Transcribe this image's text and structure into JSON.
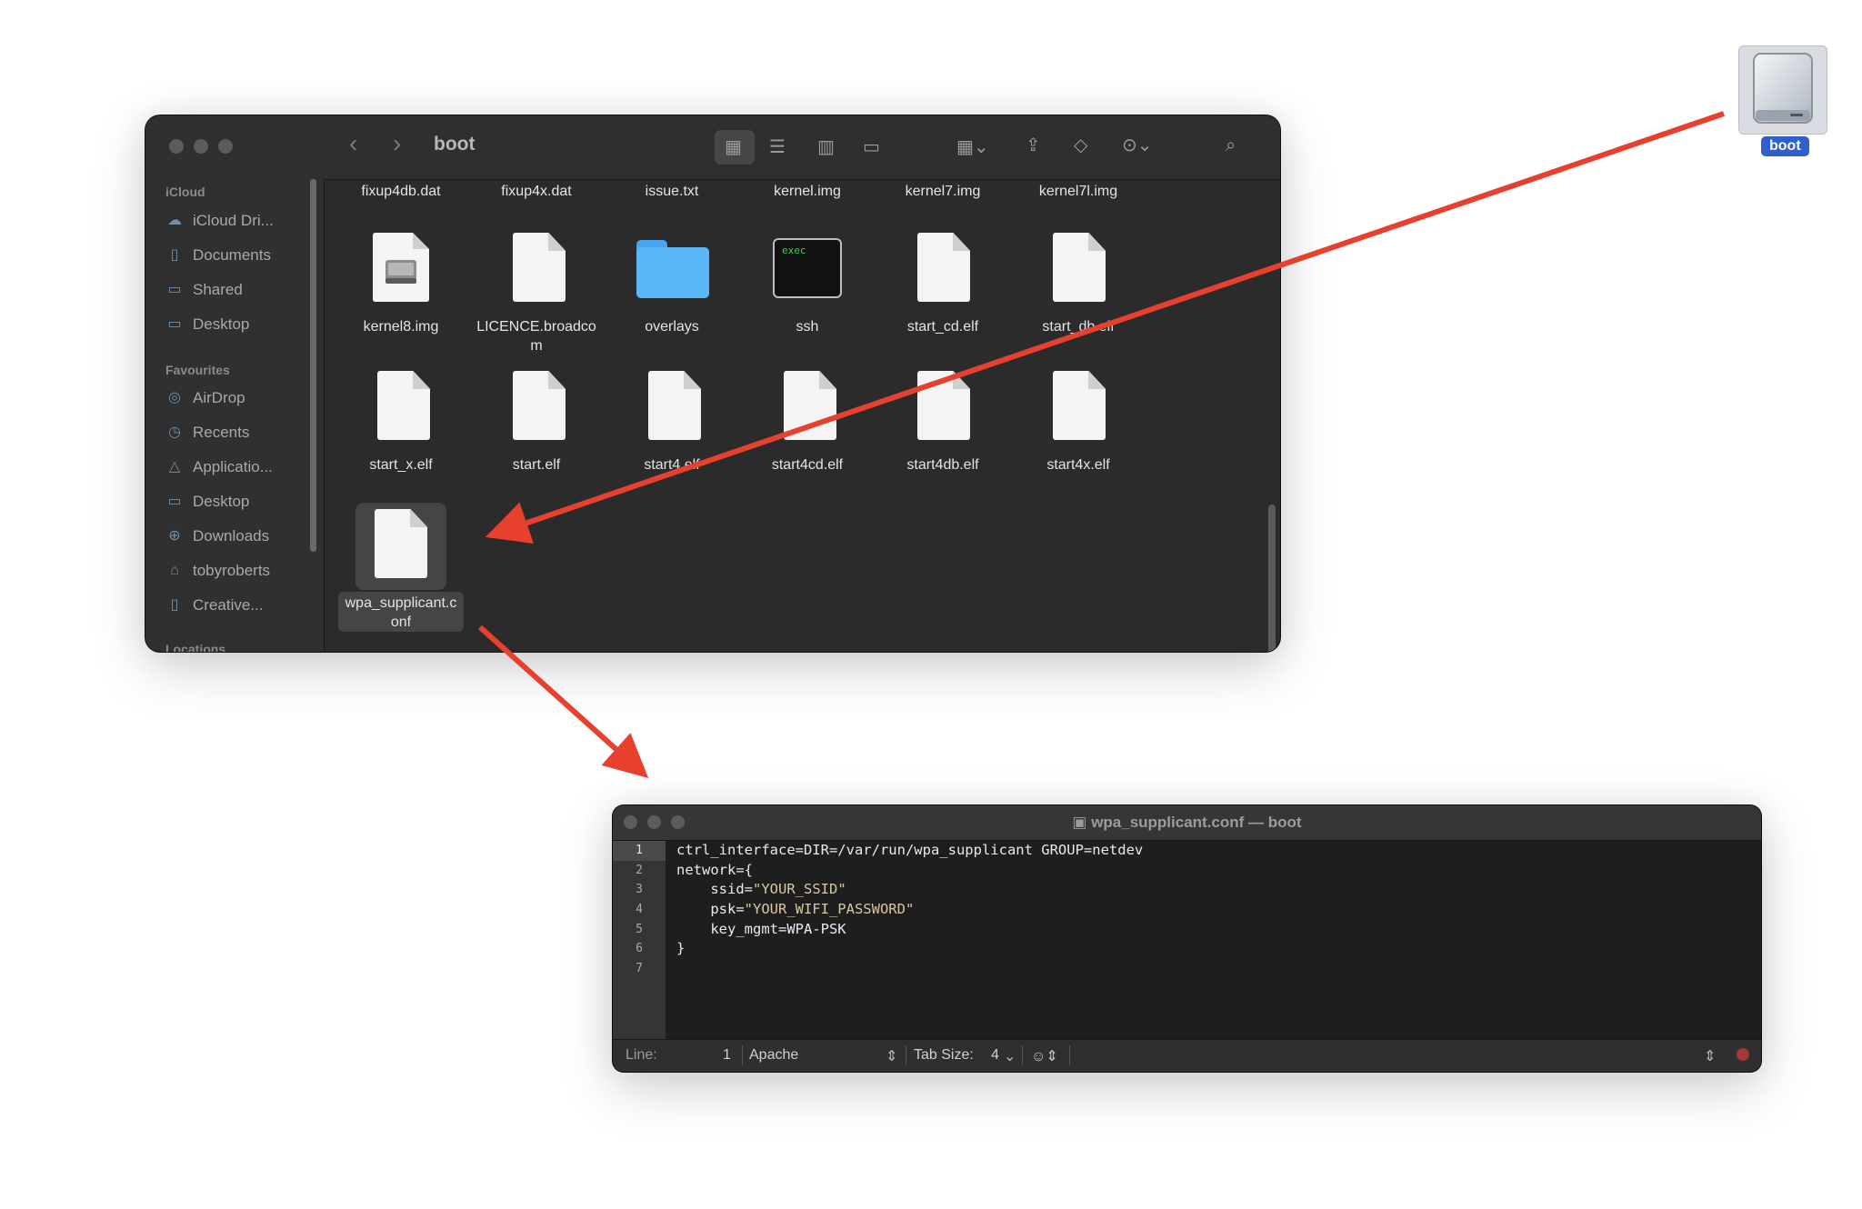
{
  "finder": {
    "path_title": "boot",
    "sidebar": {
      "sections": [
        {
          "heading": "iCloud",
          "items": [
            {
              "label": "iCloud Dri...",
              "icon": "cloud-icon"
            },
            {
              "label": "Documents",
              "icon": "document-icon"
            },
            {
              "label": "Shared",
              "icon": "shared-folder-icon"
            },
            {
              "label": "Desktop",
              "icon": "desktop-icon"
            }
          ]
        },
        {
          "heading": "Favourites",
          "items": [
            {
              "label": "AirDrop",
              "icon": "airdrop-icon"
            },
            {
              "label": "Recents",
              "icon": "clock-icon"
            },
            {
              "label": "Applicatio...",
              "icon": "applications-icon"
            },
            {
              "label": "Desktop",
              "icon": "desktop-icon"
            },
            {
              "label": "Downloads",
              "icon": "download-icon"
            },
            {
              "label": "tobyroberts",
              "icon": "home-icon"
            },
            {
              "label": "Creative...",
              "icon": "document-icon"
            }
          ]
        },
        {
          "heading": "Locations",
          "items": []
        }
      ]
    },
    "top_row_labels": [
      "fixup4db.dat",
      "fixup4x.dat",
      "issue.txt",
      "kernel.img",
      "kernel7.img",
      "kernel7l.img"
    ],
    "row2": [
      {
        "name": "kernel8.img",
        "kind": "disk-image"
      },
      {
        "name_line1": "LICENCE.broadco",
        "name_line2": "m",
        "kind": "document"
      },
      {
        "name": "overlays",
        "kind": "folder"
      },
      {
        "name": "ssh",
        "kind": "terminal",
        "badge": "exec"
      },
      {
        "name": "start_cd.elf",
        "kind": "document"
      },
      {
        "name": "start_db.elf",
        "kind": "document"
      }
    ],
    "row3": [
      {
        "name": "start_x.elf",
        "kind": "document"
      },
      {
        "name": "start.elf",
        "kind": "document"
      },
      {
        "name": "start4.elf",
        "kind": "document"
      },
      {
        "name": "start4cd.elf",
        "kind": "document"
      },
      {
        "name": "start4db.elf",
        "kind": "document"
      },
      {
        "name": "start4x.elf",
        "kind": "document"
      }
    ],
    "selected": {
      "name_line1": "wpa_supplicant.c",
      "name_line2": "onf",
      "kind": "document"
    }
  },
  "drive": {
    "label": "boot",
    "icon": "external-drive-icon"
  },
  "editor": {
    "title": "wpa_supplicant.conf — boot",
    "line_numbers": [
      "1",
      "2",
      "3",
      "4",
      "5",
      "6",
      "7"
    ],
    "lines": [
      {
        "plain": "ctrl_interface=DIR=/var/run/wpa_supplicant GROUP=netdev",
        "str": ""
      },
      {
        "plain": "network={",
        "str": ""
      },
      {
        "plain": "    ssid=",
        "str": "\"YOUR_SSID\""
      },
      {
        "plain": "    psk=",
        "str": "\"YOUR_WIFI_PASSWORD\""
      },
      {
        "plain": "    key_mgmt=WPA-PSK",
        "str": ""
      },
      {
        "plain": "}",
        "str": ""
      },
      {
        "plain": "",
        "str": ""
      }
    ],
    "status": {
      "line_label": "Line:",
      "line_value": "1",
      "language": "Apache",
      "tab_size_label": "Tab Size:",
      "tab_size_value": "4"
    }
  },
  "colors": {
    "arrow": "#e8402f",
    "drive_badge": "#2f5fcf"
  }
}
